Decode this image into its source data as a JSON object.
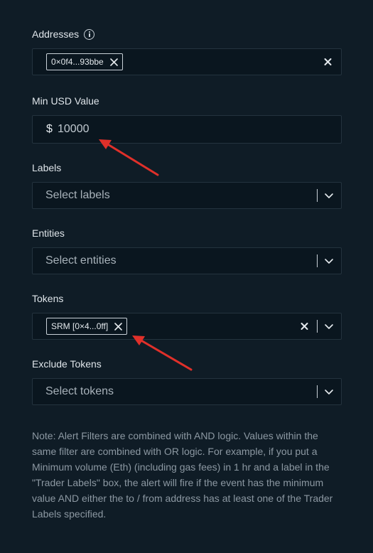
{
  "addresses": {
    "label": "Addresses",
    "chip": "0×0f4...93bbe"
  },
  "min_usd": {
    "label": "Min USD Value",
    "prefix": "$",
    "value": "10000"
  },
  "labels": {
    "label": "Labels",
    "placeholder": "Select labels"
  },
  "entities": {
    "label": "Entities",
    "placeholder": "Select entities"
  },
  "tokens": {
    "label": "Tokens",
    "chip": "SRM [0×4...0ff]"
  },
  "exclude_tokens": {
    "label": "Exclude Tokens",
    "placeholder": "Select tokens"
  },
  "note": "Note: Alert Filters are combined with AND logic. Values within the same filter are combined with OR logic. For example, if you put a Minimum volume (Eth) (including gas fees) in 1 hr and a label in the \"Trader Labels\" box, the alert will fire if the event has the minimum value AND either the to / from address has at least one of the Trader Labels specified.",
  "colors": {
    "background": "#0f1c26",
    "annotation_arrow": "#e0302a"
  }
}
